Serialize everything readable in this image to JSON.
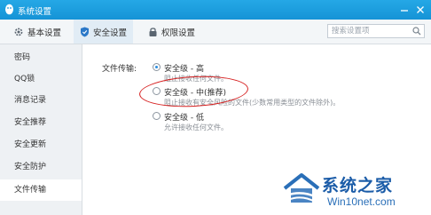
{
  "window": {
    "title": "系统设置"
  },
  "toolbar": {
    "tabs": [
      {
        "label": "基本设置",
        "icon": "gear-icon",
        "active": false
      },
      {
        "label": "安全设置",
        "icon": "shield-icon",
        "active": true
      },
      {
        "label": "权限设置",
        "icon": "lock-icon",
        "active": false
      }
    ],
    "search": {
      "placeholder": "搜索设置项",
      "value": ""
    }
  },
  "sidebar": {
    "items": [
      {
        "label": "密码",
        "active": false
      },
      {
        "label": "QQ锁",
        "active": false
      },
      {
        "label": "消息记录",
        "active": false
      },
      {
        "label": "安全推荐",
        "active": false
      },
      {
        "label": "安全更新",
        "active": false
      },
      {
        "label": "安全防护",
        "active": false
      },
      {
        "label": "文件传输",
        "active": true
      }
    ]
  },
  "main": {
    "file_transfer": {
      "label": "文件传输:",
      "options": [
        {
          "name": "安全级 - 高",
          "desc": "阻止接收任何文件。",
          "selected": true
        },
        {
          "name": "安全级 - 中(推荐)",
          "desc": "阻止接收有安全风险的文件(少数常用类型的文件除外)。",
          "selected": false
        },
        {
          "name": "安全级 - 低",
          "desc": "允许接收任何文件。",
          "selected": false
        }
      ]
    }
  },
  "annotation": {
    "color": "#d62020"
  },
  "watermark": {
    "brand": "系统之家",
    "url": "Win10net.com"
  },
  "colors": {
    "titlebar": "#1a9ddf",
    "accent": "#2a8de0"
  }
}
